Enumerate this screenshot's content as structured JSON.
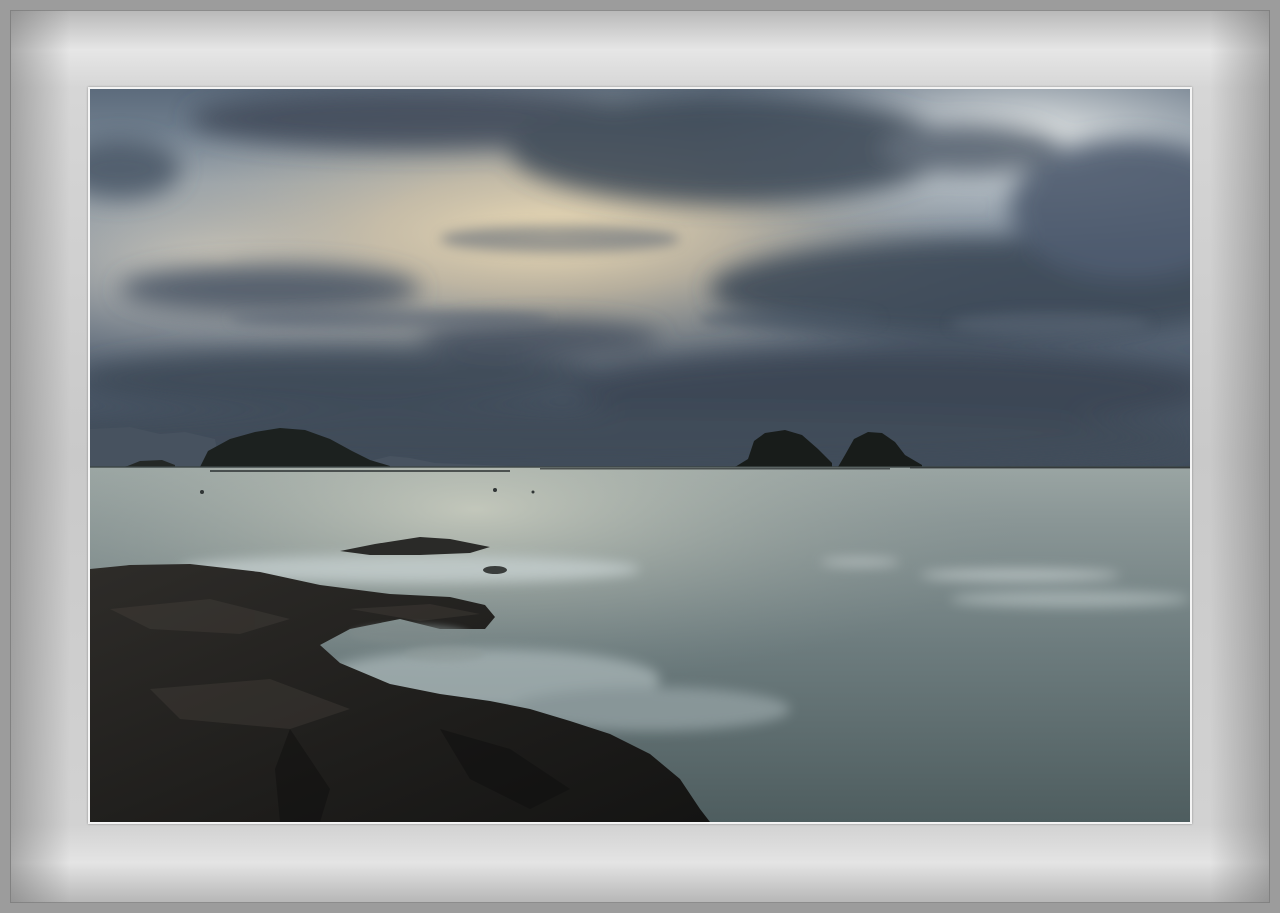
{
  "scene": {
    "subject": "seascape-at-dusk",
    "colors": {
      "frame": "#9c9c9c",
      "mat_light": "#e6e6e6",
      "mat_mid": "#c9c9c9",
      "sky_dark": "#3d4a5a",
      "sky_glow": "#f1dcae",
      "sea": "#5e6f72",
      "rock": "#1f1e1c"
    }
  }
}
